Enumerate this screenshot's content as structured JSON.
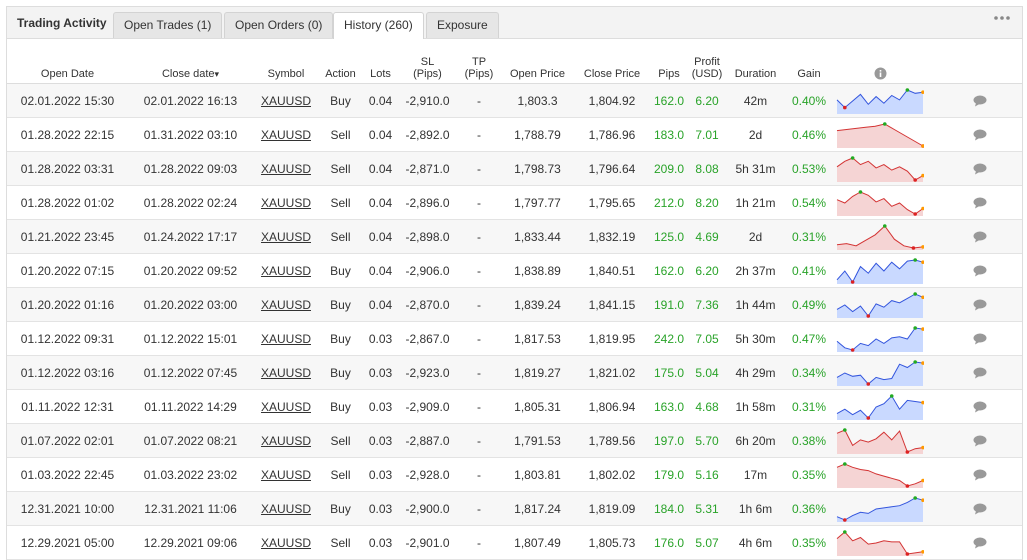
{
  "tabs": {
    "title": "Trading Activity",
    "items": [
      {
        "label": "Open Trades (1)"
      },
      {
        "label": "Open Orders (0)"
      },
      {
        "label": "History (260)"
      },
      {
        "label": "Exposure"
      }
    ],
    "more_icon": "more-dots-icon"
  },
  "columns": {
    "open_date": "Open Date",
    "close_date": "Close date",
    "sort_arrow": "▾",
    "symbol": "Symbol",
    "action": "Action",
    "lots": "Lots",
    "sl_1": "SL",
    "sl_2": "(Pips)",
    "tp_1": "TP",
    "tp_2": "(Pips)",
    "open_price": "Open Price",
    "close_price": "Close Price",
    "pips": "Pips",
    "profit_1": "Profit",
    "profit_2": "(USD)",
    "duration": "Duration",
    "gain": "Gain",
    "info_icon": "info-icon"
  },
  "colors": {
    "positive": "#29a329",
    "buy_fill": "#c9d9ff",
    "buy_line": "#3355dd",
    "sell_fill": "#f5d4d4",
    "sell_line": "#d33333"
  },
  "rows": [
    {
      "open": "02.01.2022 15:30",
      "close": "02.01.2022 16:13",
      "symbol": "XAUUSD",
      "action": "Buy",
      "lots": "0.04",
      "sl": "-2,910.0",
      "tp": "-",
      "open_price": "1,803.3",
      "close_price": "1,804.92",
      "pips": "162.0",
      "profit": "6.20",
      "duration": "42m",
      "gain": "0.40%",
      "spark": [
        0.55,
        0.2,
        0.5,
        0.8,
        0.35,
        0.7,
        0.4,
        0.75,
        0.55,
        1.0,
        0.85,
        0.9
      ]
    },
    {
      "open": "01.28.2022 22:15",
      "close": "01.31.2022 03:10",
      "symbol": "XAUUSD",
      "action": "Sell",
      "lots": "0.04",
      "sl": "-2,892.0",
      "tp": "-",
      "open_price": "1,788.79",
      "close_price": "1,786.96",
      "pips": "183.0",
      "profit": "7.01",
      "duration": "2d",
      "gain": "0.46%",
      "spark": [
        0.7,
        0.75,
        0.8,
        0.85,
        0.9,
        1.0,
        0.75,
        0.5,
        0.25,
        0.0
      ]
    },
    {
      "open": "01.28.2022 03:31",
      "close": "01.28.2022 09:03",
      "symbol": "XAUUSD",
      "action": "Sell",
      "lots": "0.04",
      "sl": "-2,871.0",
      "tp": "-",
      "open_price": "1,798.73",
      "close_price": "1,796.64",
      "pips": "209.0",
      "profit": "8.08",
      "duration": "5h 31m",
      "gain": "0.53%",
      "spark": [
        0.6,
        0.85,
        1.0,
        0.7,
        0.85,
        0.55,
        0.7,
        0.45,
        0.6,
        0.4,
        0.0,
        0.2
      ]
    },
    {
      "open": "01.28.2022 01:02",
      "close": "01.28.2022 02:24",
      "symbol": "XAUUSD",
      "action": "Sell",
      "lots": "0.04",
      "sl": "-2,896.0",
      "tp": "-",
      "open_price": "1,797.77",
      "close_price": "1,795.65",
      "pips": "212.0",
      "profit": "8.20",
      "duration": "1h 21m",
      "gain": "0.54%",
      "spark": [
        0.65,
        0.5,
        0.8,
        1.0,
        0.85,
        0.55,
        0.7,
        0.35,
        0.5,
        0.2,
        0.0,
        0.25
      ]
    },
    {
      "open": "01.21.2022 23:45",
      "close": "01.24.2022 17:17",
      "symbol": "XAUUSD",
      "action": "Sell",
      "lots": "0.04",
      "sl": "-2,898.0",
      "tp": "-",
      "open_price": "1,833.44",
      "close_price": "1,832.19",
      "pips": "125.0",
      "profit": "4.69",
      "duration": "2d",
      "gain": "0.31%",
      "spark": [
        0.15,
        0.2,
        0.1,
        0.35,
        0.6,
        1.0,
        0.4,
        0.1,
        0.0,
        0.05
      ]
    },
    {
      "open": "01.20.2022 07:15",
      "close": "01.20.2022 09:52",
      "symbol": "XAUUSD",
      "action": "Buy",
      "lots": "0.04",
      "sl": "-2,906.0",
      "tp": "-",
      "open_price": "1,838.89",
      "close_price": "1,840.51",
      "pips": "162.0",
      "profit": "6.20",
      "duration": "2h 37m",
      "gain": "0.41%",
      "spark": [
        0.1,
        0.5,
        0.0,
        0.7,
        0.4,
        0.85,
        0.5,
        0.9,
        0.6,
        0.95,
        1.0,
        0.9
      ]
    },
    {
      "open": "01.20.2022 01:16",
      "close": "01.20.2022 03:00",
      "symbol": "XAUUSD",
      "action": "Buy",
      "lots": "0.04",
      "sl": "-2,870.0",
      "tp": "-",
      "open_price": "1,839.24",
      "close_price": "1,841.15",
      "pips": "191.0",
      "profit": "7.36",
      "duration": "1h 44m",
      "gain": "0.49%",
      "spark": [
        0.3,
        0.5,
        0.2,
        0.45,
        0.0,
        0.55,
        0.4,
        0.7,
        0.6,
        0.8,
        1.0,
        0.85
      ]
    },
    {
      "open": "01.12.2022 09:31",
      "close": "01.12.2022 15:01",
      "symbol": "XAUUSD",
      "action": "Buy",
      "lots": "0.03",
      "sl": "-2,867.0",
      "tp": "-",
      "open_price": "1,817.53",
      "close_price": "1,819.95",
      "pips": "242.0",
      "profit": "7.05",
      "duration": "5h 30m",
      "gain": "0.47%",
      "spark": [
        0.4,
        0.1,
        0.0,
        0.3,
        0.2,
        0.5,
        0.3,
        0.55,
        0.6,
        0.5,
        1.0,
        0.95
      ]
    },
    {
      "open": "01.12.2022 03:16",
      "close": "01.12.2022 07:45",
      "symbol": "XAUUSD",
      "action": "Buy",
      "lots": "0.03",
      "sl": "-2,923.0",
      "tp": "-",
      "open_price": "1,819.27",
      "close_price": "1,821.02",
      "pips": "175.0",
      "profit": "5.04",
      "duration": "4h 29m",
      "gain": "0.34%",
      "spark": [
        0.3,
        0.5,
        0.35,
        0.4,
        0.0,
        0.3,
        0.2,
        0.25,
        0.9,
        0.75,
        1.0,
        0.95
      ]
    },
    {
      "open": "01.11.2022 12:31",
      "close": "01.11.2022 14:29",
      "symbol": "XAUUSD",
      "action": "Buy",
      "lots": "0.03",
      "sl": "-2,909.0",
      "tp": "-",
      "open_price": "1,805.31",
      "close_price": "1,806.94",
      "pips": "163.0",
      "profit": "4.68",
      "duration": "1h 58m",
      "gain": "0.31%",
      "spark": [
        0.2,
        0.4,
        0.15,
        0.35,
        0.0,
        0.5,
        0.65,
        1.0,
        0.4,
        0.8,
        0.75,
        0.7
      ]
    },
    {
      "open": "01.07.2022 02:01",
      "close": "01.07.2022 08:21",
      "symbol": "XAUUSD",
      "action": "Sell",
      "lots": "0.03",
      "sl": "-2,887.0",
      "tp": "-",
      "open_price": "1,791.53",
      "close_price": "1,789.56",
      "pips": "197.0",
      "profit": "5.70",
      "duration": "6h 20m",
      "gain": "0.38%",
      "spark": [
        0.85,
        1.0,
        0.3,
        0.55,
        0.45,
        0.6,
        0.9,
        0.55,
        0.95,
        0.0,
        0.15,
        0.2
      ]
    },
    {
      "open": "01.03.2022 22:45",
      "close": "01.03.2022 23:02",
      "symbol": "XAUUSD",
      "action": "Sell",
      "lots": "0.03",
      "sl": "-2,928.0",
      "tp": "-",
      "open_price": "1,803.81",
      "close_price": "1,802.02",
      "pips": "179.0",
      "profit": "5.16",
      "duration": "17m",
      "gain": "0.35%",
      "spark": [
        0.85,
        1.0,
        0.85,
        0.75,
        0.7,
        0.55,
        0.45,
        0.35,
        0.25,
        0.0,
        0.1,
        0.25
      ]
    },
    {
      "open": "12.31.2021 10:00",
      "close": "12.31.2021 11:06",
      "symbol": "XAUUSD",
      "action": "Buy",
      "lots": "0.03",
      "sl": "-2,900.0",
      "tp": "-",
      "open_price": "1,817.24",
      "close_price": "1,819.09",
      "pips": "184.0",
      "profit": "5.31",
      "duration": "1h 6m",
      "gain": "0.36%",
      "spark": [
        0.15,
        0.0,
        0.2,
        0.35,
        0.3,
        0.5,
        0.55,
        0.6,
        0.65,
        0.8,
        1.0,
        0.9
      ]
    },
    {
      "open": "12.29.2021 05:00",
      "close": "12.29.2021 09:06",
      "symbol": "XAUUSD",
      "action": "Sell",
      "lots": "0.03",
      "sl": "-2,901.0",
      "tp": "-",
      "open_price": "1,807.49",
      "close_price": "1,805.73",
      "pips": "176.0",
      "profit": "5.07",
      "duration": "4h 6m",
      "gain": "0.35%",
      "spark": [
        0.7,
        1.0,
        0.6,
        0.75,
        0.45,
        0.5,
        0.6,
        0.55,
        0.55,
        0.0,
        0.05,
        0.1
      ]
    }
  ]
}
